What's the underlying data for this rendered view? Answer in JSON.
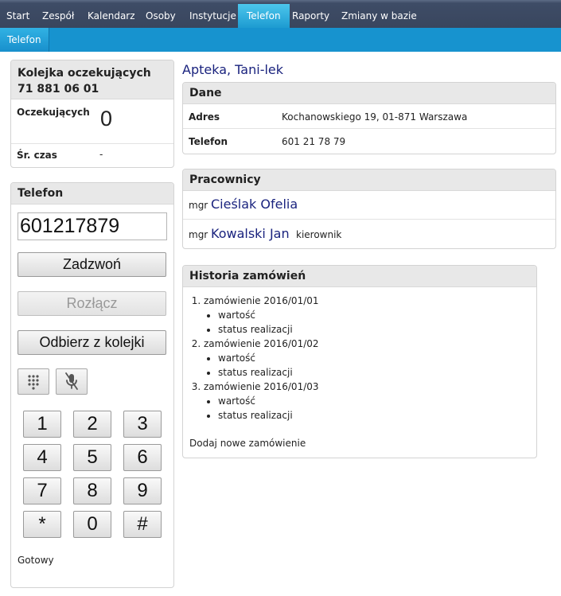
{
  "nav": {
    "items": [
      "Start",
      "Zespół",
      "Kalendarz",
      "Osoby",
      "Instytucje",
      "Telefon",
      "Raporty",
      "Zmiany w bazie"
    ],
    "active": "Telefon",
    "sub_tab": "Telefon"
  },
  "queue": {
    "title_line1": "Kolejka oczekujących",
    "title_line2": "71 881 06 01",
    "waiting_label": "Oczekujących",
    "waiting_value": "0",
    "avg_label": "Śr. czas",
    "avg_value": "-"
  },
  "phone": {
    "title": "Telefon",
    "number": "601217879",
    "call_label": "Zadzwoń",
    "hangup_label": "Rozłącz",
    "pickup_label": "Odbierz z kolejki",
    "keys": [
      "1",
      "2",
      "3",
      "4",
      "5",
      "6",
      "7",
      "8",
      "9",
      "*",
      "0",
      "#"
    ],
    "status": "Gotowy"
  },
  "institution": {
    "name": "Apteka, Tani-lek",
    "details_title": "Dane",
    "address_label": "Adres",
    "address_value": "Kochanowskiego 19, 01-871 Warszawa",
    "phone_label": "Telefon",
    "phone_value": "601 21 78 79"
  },
  "staff": {
    "title": "Pracownicy",
    "people": [
      {
        "prefix": "mgr",
        "name": "Cieślak Ofelia",
        "role": ""
      },
      {
        "prefix": "mgr",
        "name": "Kowalski Jan",
        "role": "kierownik"
      }
    ]
  },
  "orders": {
    "title": "Historia zamówień",
    "items": [
      {
        "label": "zamówienie 2016/01/01",
        "subs": [
          "wartość",
          "status realizacji"
        ]
      },
      {
        "label": "zamówienie 2016/01/02",
        "subs": [
          "wartość",
          "status realizacji"
        ]
      },
      {
        "label": "zamówienie 2016/01/03",
        "subs": [
          "wartość",
          "status realizacji"
        ]
      }
    ],
    "add_label": "Dodaj nowe zamówienie"
  },
  "colors": {
    "nav_bg": "#3e4c66",
    "nav_active": "#1d9bd1",
    "subnav_bg": "#1793cf",
    "link": "#1a237e"
  },
  "icons": [
    "dialpad-icon",
    "mute-microphone-icon"
  ]
}
